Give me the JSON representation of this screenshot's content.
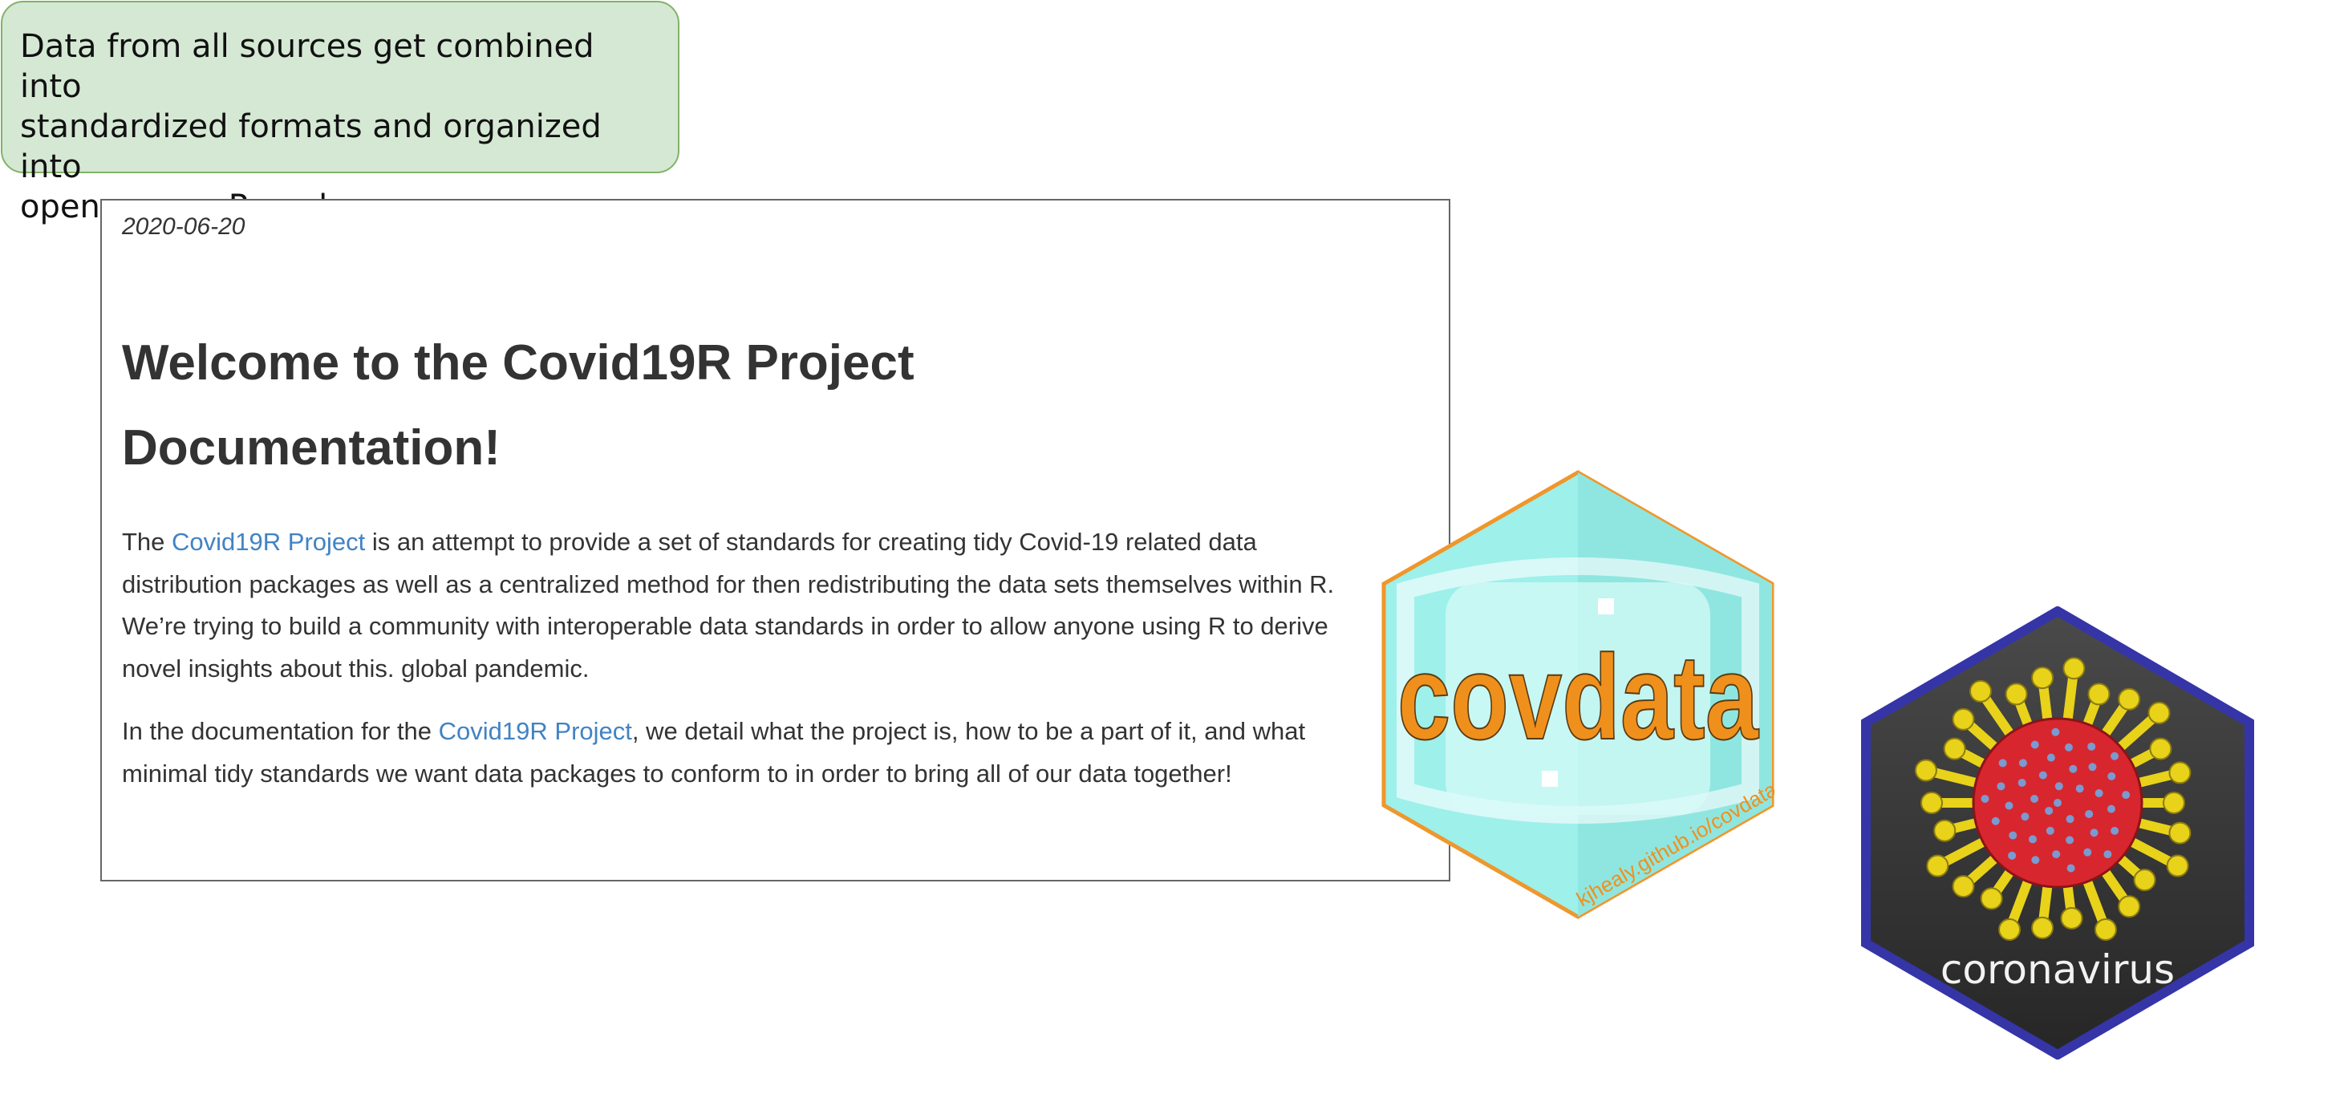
{
  "callout": {
    "text": "Data from all sources get combined into\nstandardized formats and organized into\nopen-source R packages"
  },
  "doc": {
    "date": "2020-06-20",
    "title": "Welcome to the Covid19R Project Documentation!",
    "paragraph1": {
      "prefix": "The ",
      "link": "Covid19R Project",
      "suffix": " is an attempt to provide a set of standards for creating tidy Covid-19 related data distribution packages as well as a centralized method for then redistributing the data sets themselves within R. We’re trying to build a community with interoperable data standards in order to allow anyone using R to derive novel insights about this. global pandemic."
    },
    "paragraph2": {
      "prefix": "In the documentation for the ",
      "link": "Covid19R Project",
      "suffix": ", we detail what the project is, how to be a part of it, and what minimal tidy standards we want data packages to conform to in order to bring all of our data together!"
    }
  },
  "logos": {
    "covdata": {
      "wordmark": "covdata",
      "url_text": "kjhealy.github.io/covdata",
      "icon": "face-mask-icon",
      "colors": {
        "fill": "#9ef0ea",
        "border": "#f0962a",
        "text": "#f0901c"
      }
    },
    "coronavirus": {
      "wordmark": "coronavirus",
      "icon": "virus-icon",
      "colors": {
        "fill": "#3a3a3a",
        "border": "#3535a8",
        "spike": "#e8d21a",
        "core": "#d8262e"
      }
    }
  }
}
